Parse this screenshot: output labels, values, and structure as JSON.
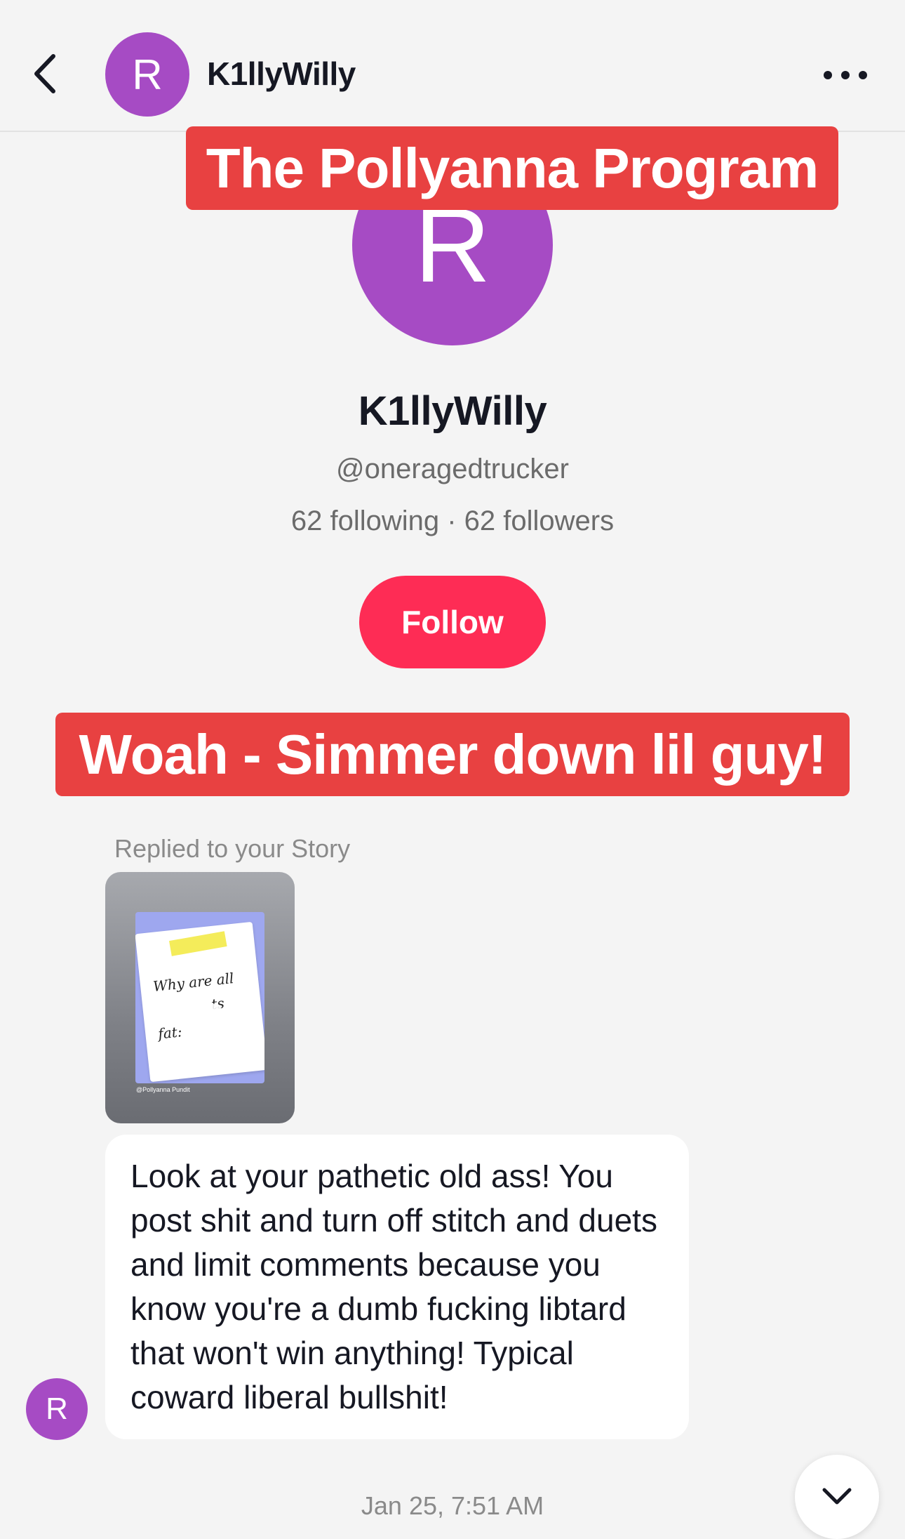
{
  "header": {
    "avatar_letter": "R",
    "username": "K1llyWilly",
    "back_icon": "chevron-left-icon",
    "more_icon": "more-horizontal-icon"
  },
  "overlays": {
    "top_banner": "The Pollyanna Program",
    "middle_banner": "Woah - Simmer down lil guy!",
    "banner_color": "#e84141"
  },
  "profile": {
    "avatar_letter": "R",
    "display_name": "K1llyWilly",
    "handle": "@oneragedtrucker",
    "stats": "62 following · 62 followers",
    "follow_label": "Follow",
    "avatar_color": "#a64bc4",
    "follow_color": "#fe2c55"
  },
  "conversation": {
    "reply_label": "Replied to your Story",
    "story": {
      "note_text_lines": [
        "Why are all",
        "ts",
        "fat:"
      ],
      "caption": "@Pollyanna Pundit"
    },
    "message": "Look at your pathetic old ass! You post shit and turn off stitch and duets and limit comments because you know you're a dumb fucking libtard that won't win anything! Typical coward liberal bullshit!",
    "sender_avatar_letter": "R",
    "timestamp": "Jan 25, 7:51 AM"
  }
}
